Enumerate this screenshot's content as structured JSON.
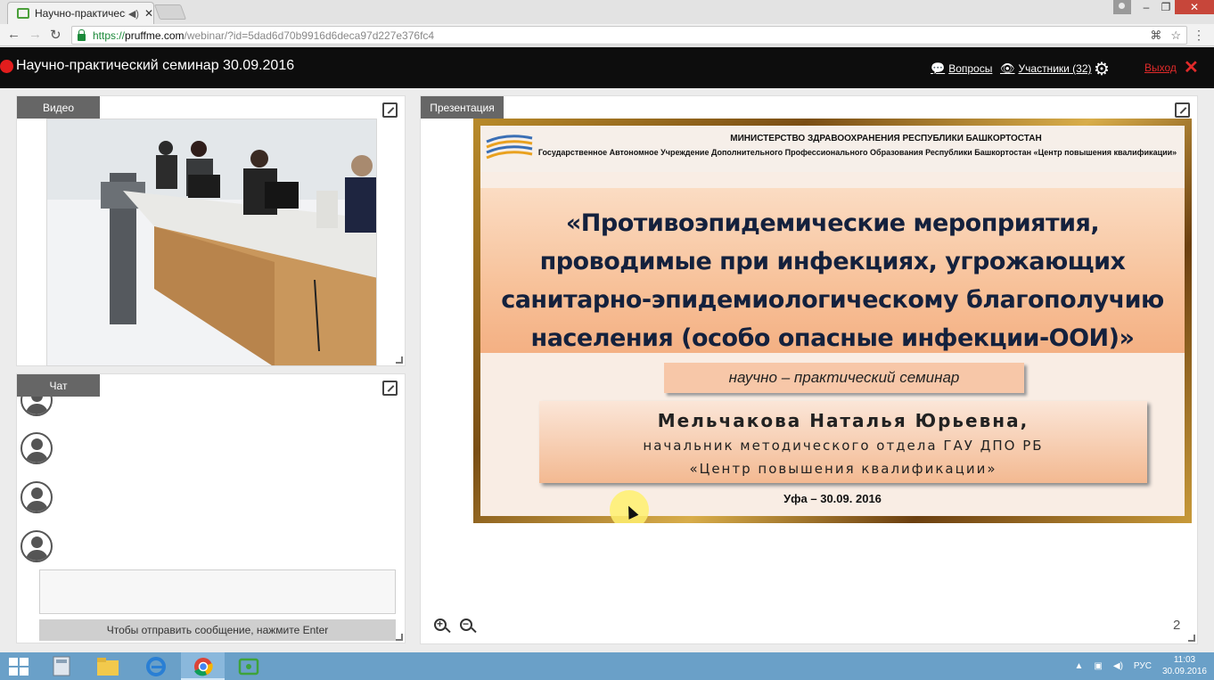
{
  "browser": {
    "tab_title": "Научно-практически",
    "tab_audio": "◀)",
    "tab_close": "✕",
    "url_scheme": "https://",
    "url_host": "pruffme.com",
    "url_path": "/webinar/?id=5dad6d70b9916d6deca97d227e376fc4",
    "win_min": "–",
    "win_restore": "❐",
    "win_close": "✕"
  },
  "header": {
    "event_title": "Научно-практический семинар 30.09.2016",
    "questions_label": "Вопросы",
    "participants_label": "Участники (32)",
    "exit_label": "Выход"
  },
  "video_panel": {
    "tab_label": "Видео"
  },
  "chat_panel": {
    "tab_label": "Чат",
    "hint": "Чтобы отправить сообщение, нажмите Enter"
  },
  "presentation_panel": {
    "tab_label": "Презентация",
    "page_number": "2",
    "slide": {
      "ministry": "МИНИСТЕРСТВО ЗДРАВООХРАНЕНИЯ РЕСПУБЛИКИ БАШКОРТОСТАН",
      "org": "Государственное Автономное Учреждение Дополнительного Профессионального Образования Республики Башкортостан «Центр повышения квалификации»",
      "title_line1": "«Противоэпидемические мероприятия,",
      "title_line2": "проводимые при инфекциях, угрожающих",
      "title_line3": "санитарно-эпидемиологическому благополучию",
      "title_line4": "населения (особо опасные инфекции-ООИ)»",
      "subtitle": "научно – практический семинар",
      "author": "Мельчакова Наталья Юрьевна,",
      "position_line1": "начальник методического отдела ГАУ ДПО РБ",
      "position_line2": "«Центр повышения квалификации»",
      "footer": "Уфа – 30.09. 2016"
    }
  },
  "taskbar": {
    "lang": "РУС",
    "time": "11:03",
    "date": "30.09.2016"
  },
  "colors": {
    "header_bg": "#0d0d0d",
    "record": "#e21d1d",
    "exit": "#e02a2a",
    "panel_tab": "#666666",
    "taskbar": "#6aa0c8"
  }
}
